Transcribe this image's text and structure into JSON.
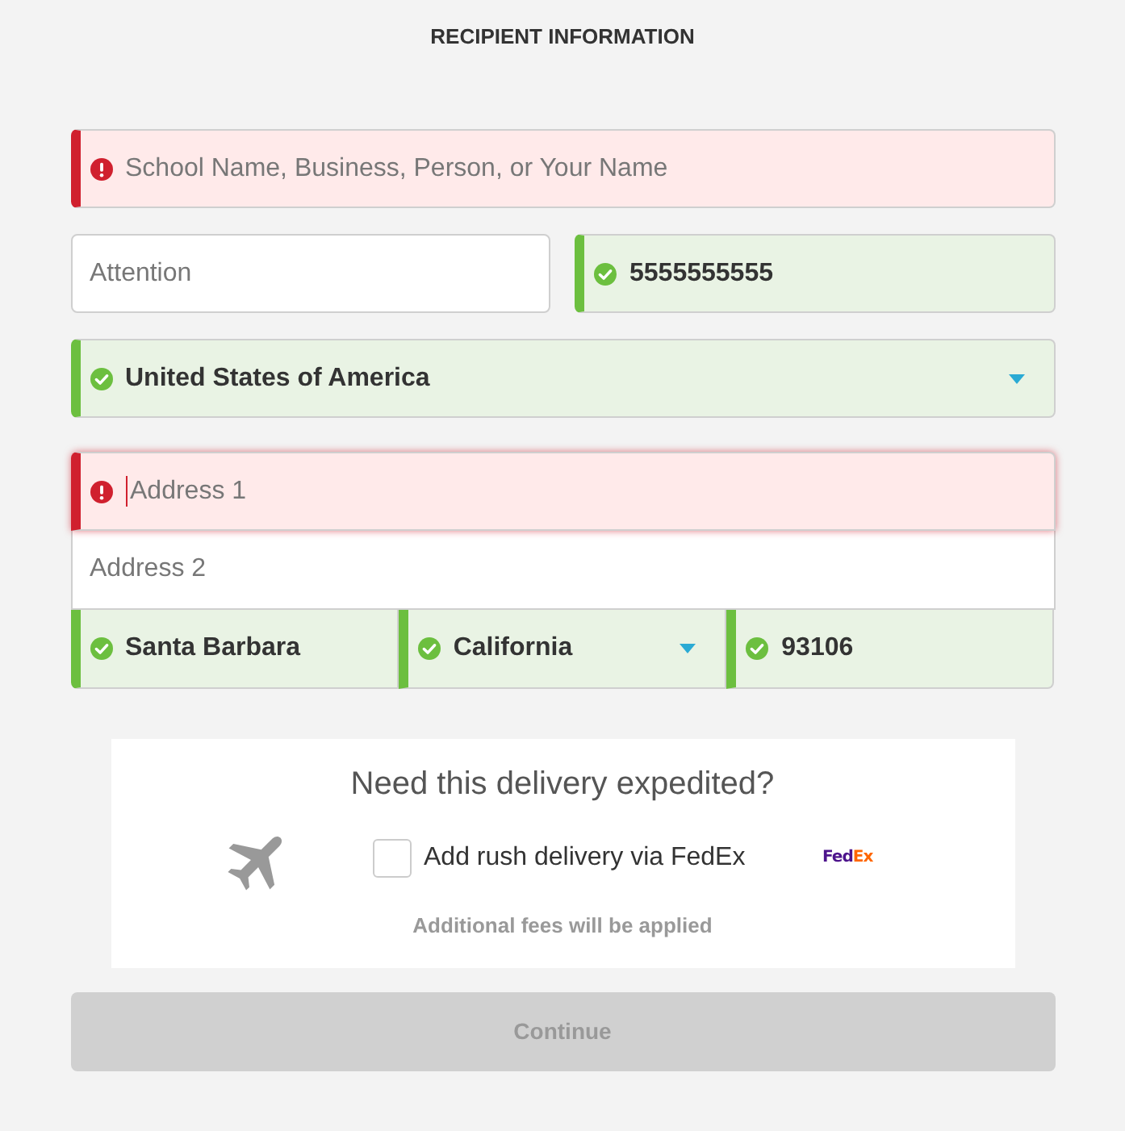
{
  "title": "RECIPIENT INFORMATION",
  "field_groups": [
    {
      "rows": [
        {
          "fields": [
            {
              "kind": "text",
              "placeholder": "School Name, Business, Person, or Your Name",
              "error": true,
              "valid": false,
              "focused": false
            }
          ]
        }
      ]
    },
    {
      "rows": [
        {
          "fields": [
            {
              "kind": "text",
              "placeholder": "Attention",
              "error": false,
              "valid": false,
              "focused": false
            },
            {
              "kind": "text",
              "value": "5555555555",
              "error": false,
              "valid": true,
              "focused": false
            }
          ]
        }
      ]
    },
    {
      "rows": [
        {
          "fields": [
            {
              "kind": "select",
              "value": "United States of America",
              "error": false,
              "valid": true,
              "focused": false
            }
          ]
        }
      ]
    },
    {
      "rows": [
        {
          "fields": [
            {
              "kind": "text",
              "placeholder": "Address 1",
              "error": true,
              "valid": false,
              "focused": true
            }
          ]
        },
        {
          "fields": [
            {
              "kind": "text",
              "placeholder": "Address 2",
              "error": false,
              "valid": false,
              "focused": false
            }
          ]
        },
        {
          "fields": [
            {
              "kind": "text",
              "value": "Santa Barbara",
              "error": false,
              "valid": true,
              "focused": false
            },
            {
              "kind": "select",
              "value": "California",
              "error": false,
              "valid": true,
              "focused": false
            },
            {
              "kind": "text",
              "value": "93106",
              "error": false,
              "valid": true,
              "focused": false
            }
          ]
        }
      ]
    }
  ],
  "expedite": {
    "title": "Need this delivery expedited?",
    "checkbox": {
      "label": "Add rush delivery via FedEx",
      "checked": false
    },
    "logo": [
      {
        "text": "Fed",
        "color": "#4d148c"
      },
      {
        "text": "Ex",
        "color": "#ff6600"
      }
    ],
    "note": "Additional fees will be applied"
  },
  "continue_button": {
    "label": "Continue",
    "disabled": true
  }
}
